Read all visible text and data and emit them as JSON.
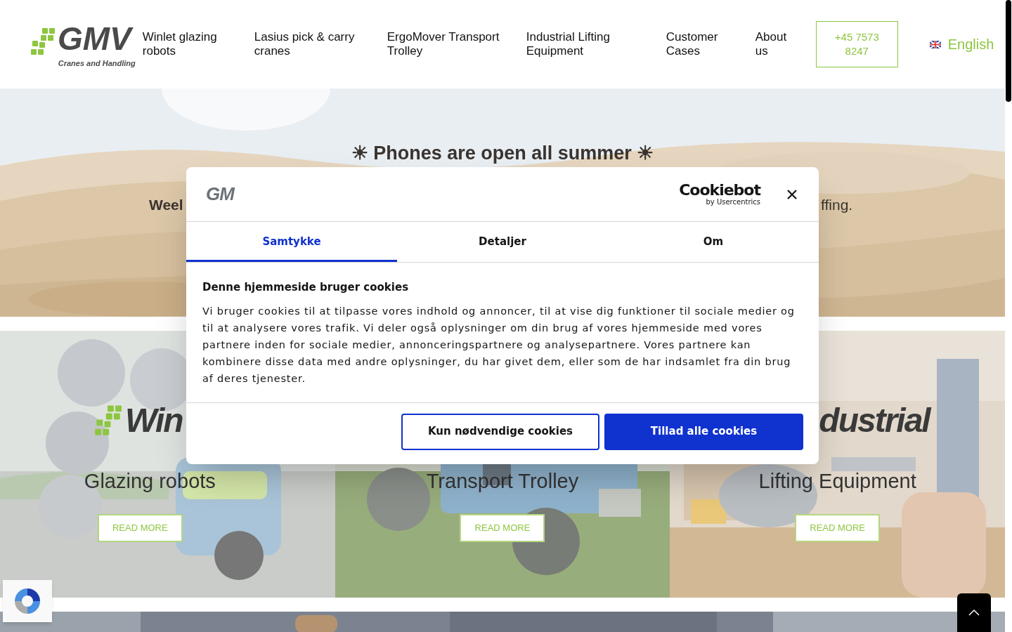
{
  "header": {
    "logo": {
      "wordmark": "GMV",
      "tagline": "Cranes and Handling"
    },
    "nav": [
      {
        "label": "Winlet glazing robots"
      },
      {
        "label": "Lasius pick & carry cranes"
      },
      {
        "label": "ErgoMover Transport Trolley"
      },
      {
        "label": "Industrial Lifting Equipment"
      },
      {
        "label": "Customer Cases"
      },
      {
        "label": "About us"
      }
    ],
    "phone": "+45 7573 8247",
    "language": "English"
  },
  "hero": {
    "heading": "☀ Phones are open all summer ☀",
    "text_left": "Weel",
    "text_right": "ffing."
  },
  "cards": [
    {
      "title": "Win",
      "logo_mark": true,
      "subtitle": "Glazing robots",
      "button": "READ MORE",
      "kind": "picture"
    },
    {
      "subtitle": "Transport Trolley",
      "button": "READ MORE",
      "kind": "picture"
    },
    {
      "title": "dustrial",
      "subtitle": "Lifting Equipment",
      "button": "READ MORE",
      "kind": "picture"
    }
  ],
  "cookie_dialog": {
    "logo": "GM",
    "brand": "Cookiebot",
    "brand_sub": "by Usercentrics",
    "tabs": [
      {
        "label": "Samtykke",
        "selected": true
      },
      {
        "label": "Detaljer",
        "selected": false
      },
      {
        "label": "Om",
        "selected": false
      }
    ],
    "heading": "Denne hjemmeside bruger cookies",
    "body": "Vi bruger cookies til at tilpasse vores indhold og annoncer, til at vise dig funktioner til sociale medier og til at analysere vores trafik. Vi deler også oplysninger om din brug af vores hjemmeside med vores partnere inden for sociale medier, annonceringspartnere og analysepartnere. Vores partnere kan kombinere disse data med andre oplysninger, du har givet dem, eller som de har indsamlet fra din brug af deres tjenester.",
    "buttons": [
      {
        "label": "Kun nødvendige cookies",
        "kind": "outline"
      },
      {
        "label": "Tillad alle cookies",
        "kind": "primary"
      }
    ]
  }
}
